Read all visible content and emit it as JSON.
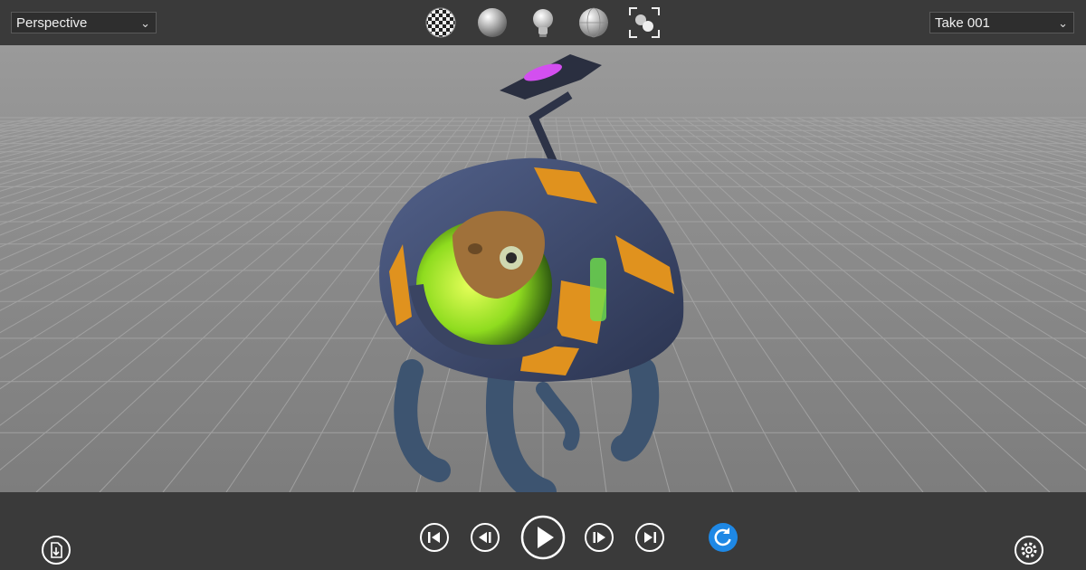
{
  "toolbar": {
    "view_mode": "Perspective",
    "take": "Take 001",
    "tools": [
      {
        "icon": "checker-texture-icon"
      },
      {
        "icon": "shaded-sphere-icon"
      },
      {
        "icon": "light-bulb-icon"
      },
      {
        "icon": "wireframe-sphere-icon"
      },
      {
        "icon": "frame-all-icon"
      }
    ]
  },
  "playback": {
    "controls": [
      {
        "icon": "skip-to-start-icon"
      },
      {
        "icon": "step-back-icon"
      },
      {
        "icon": "play-icon"
      },
      {
        "icon": "step-forward-icon"
      },
      {
        "icon": "skip-to-end-icon"
      },
      {
        "icon": "loop-icon"
      }
    ]
  },
  "colors": {
    "bar": "#3a3a3a",
    "loop_accent": "#1e88e5",
    "model_body": "#3d4a6b",
    "model_stripes": "#e0921e",
    "dome_glow": "#8fdc1f"
  }
}
